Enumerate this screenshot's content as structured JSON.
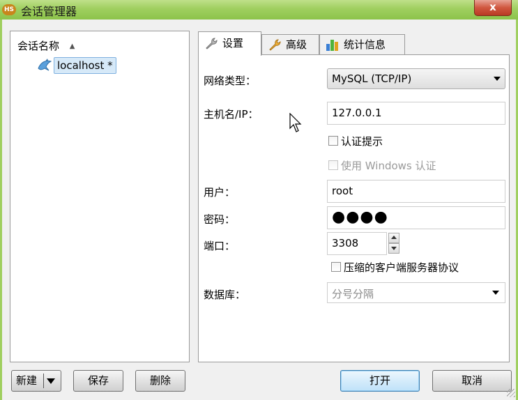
{
  "window": {
    "title": "会话管理器",
    "app_icon_text": "HS",
    "close_label": "x"
  },
  "sessions": {
    "header": "会话名称",
    "items": [
      {
        "label": "localhost *"
      }
    ]
  },
  "tabs": [
    {
      "label": "设置",
      "icon": "wrench-icon"
    },
    {
      "label": "高级",
      "icon": "wrench-icon"
    },
    {
      "label": "统计信息",
      "icon": "bar-chart-icon"
    }
  ],
  "settings": {
    "network_type_label": "网络类型：",
    "network_type_value": "MySQL (TCP/IP)",
    "host_label": "主机名/IP：",
    "host_value": "127.0.0.1",
    "auth_prompt_label": "认证提示",
    "windows_auth_label": "使用 Windows 认证",
    "user_label": "用户：",
    "user_value": "root",
    "password_label": "密码：",
    "password_value": "●●●●",
    "port_label": "端口：",
    "port_value": "3308",
    "compressed_label": "压缩的客户端服务器协议",
    "database_label": "数据库：",
    "database_placeholder": "分号分隔"
  },
  "buttons": {
    "new": "新建",
    "save": "保存",
    "delete": "删除",
    "open": "打开",
    "cancel": "取消"
  },
  "colors": {
    "titlebar": "#9fcf5f",
    "close": "#c9472f",
    "selection": "#d6e9f8"
  }
}
